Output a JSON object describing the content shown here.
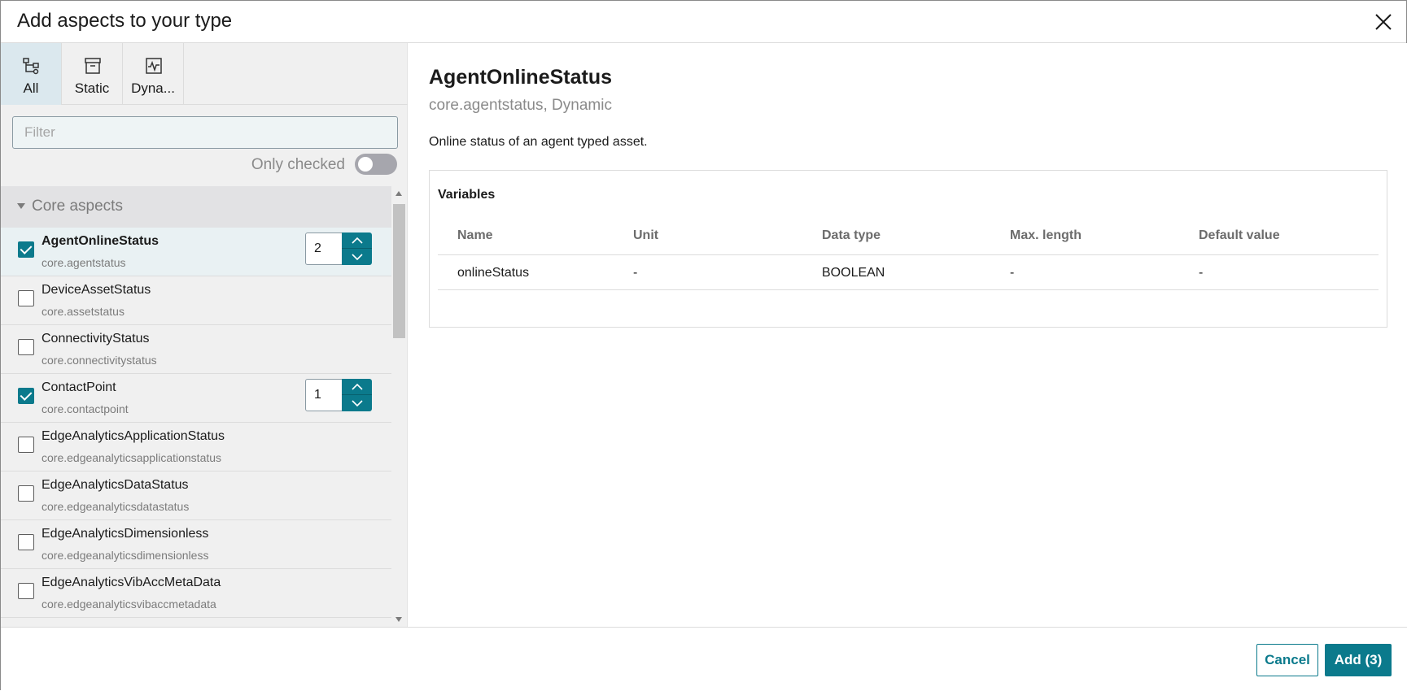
{
  "dialog": {
    "title": "Add aspects to your type",
    "close_icon": "close-icon"
  },
  "tabs": [
    {
      "label": "All",
      "icon": "hierarchy-icon",
      "active": true
    },
    {
      "label": "Static",
      "icon": "archive-icon",
      "active": false
    },
    {
      "label": "Dyna...",
      "icon": "chart-icon",
      "active": false
    }
  ],
  "filter": {
    "placeholder": "Filter",
    "value": ""
  },
  "only_checked": {
    "label": "Only checked",
    "on": false
  },
  "group": {
    "label": "Core aspects"
  },
  "items": [
    {
      "name": "AgentOnlineStatus",
      "id": "core.agentstatus",
      "checked": true,
      "count": "2"
    },
    {
      "name": "DeviceAssetStatus",
      "id": "core.assetstatus",
      "checked": false
    },
    {
      "name": "ConnectivityStatus",
      "id": "core.connectivitystatus",
      "checked": false
    },
    {
      "name": "ContactPoint",
      "id": "core.contactpoint",
      "checked": true,
      "count": "1"
    },
    {
      "name": "EdgeAnalyticsApplicationStatus",
      "id": "core.edgeanalyticsapplicationstatus",
      "checked": false
    },
    {
      "name": "EdgeAnalyticsDataStatus",
      "id": "core.edgeanalyticsdatastatus",
      "checked": false
    },
    {
      "name": "EdgeAnalyticsDimensionless",
      "id": "core.edgeanalyticsdimensionless",
      "checked": false
    },
    {
      "name": "EdgeAnalyticsVibAccMetaData",
      "id": "core.edgeanalyticsvibaccmetadata",
      "checked": false
    }
  ],
  "detail": {
    "title": "AgentOnlineStatus",
    "subtitle": "core.agentstatus, Dynamic",
    "description": "Online status of an agent typed asset.",
    "variables_title": "Variables",
    "columns": [
      "Name",
      "Unit",
      "Data type",
      "Max. length",
      "Default value"
    ],
    "rows": [
      [
        "onlineStatus",
        "-",
        "BOOLEAN",
        "-",
        "-"
      ]
    ]
  },
  "footer": {
    "cancel_label": "Cancel",
    "add_label": "Add (3)"
  },
  "colors": {
    "accent": "#0b7a8c"
  }
}
